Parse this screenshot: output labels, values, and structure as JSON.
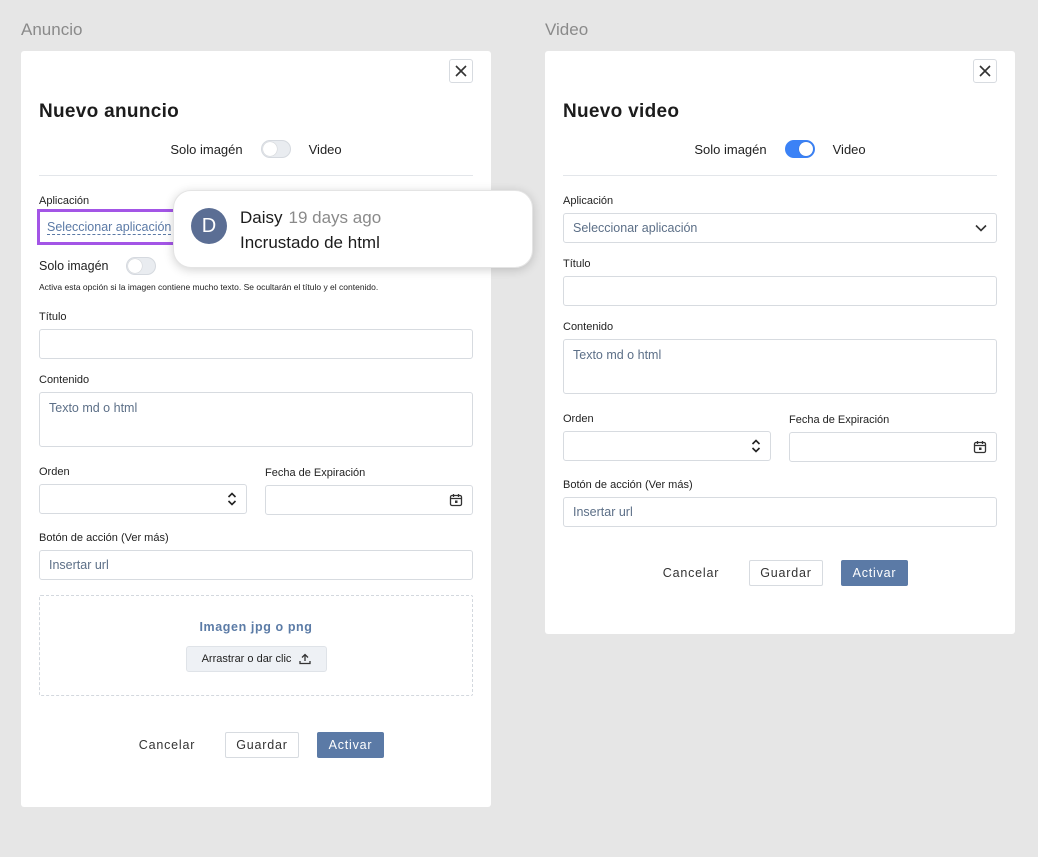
{
  "frames": {
    "left": {
      "label": "Anuncio",
      "title": "Nuevo anuncio",
      "toggle": {
        "left_label": "Solo imagén",
        "right_label": "Video",
        "on": false
      },
      "app_label": "Aplicación",
      "app_placeholder": "Seleccionar aplicación",
      "solo_label": "Solo imagén",
      "solo_hint": "Activa esta opción si la imagen contiene mucho texto. Se ocultarán el título y el contenido.",
      "titulo_label": "Título",
      "contenido_label": "Contenido",
      "contenido_placeholder": "Texto md o html",
      "orden_label": "Orden",
      "fecha_label": "Fecha de Expiración",
      "accion_label": "Botón de acción (Ver más)",
      "accion_placeholder": "Insertar url",
      "dropzone_title": "Imagen jpg o png",
      "dropzone_button": "Arrastrar o dar clic",
      "cancel": "Cancelar",
      "save": "Guardar",
      "activate": "Activar"
    },
    "right": {
      "label": "Video",
      "title": "Nuevo video",
      "toggle": {
        "left_label": "Solo imagén",
        "right_label": "Video",
        "on": true
      },
      "app_label": "Aplicación",
      "app_placeholder": "Seleccionar aplicación",
      "titulo_label": "Título",
      "contenido_label": "Contenido",
      "contenido_placeholder": "Texto md o html",
      "orden_label": "Orden",
      "fecha_label": "Fecha de Expiración",
      "accion_label": "Botón de acción (Ver más)",
      "accion_placeholder": "Insertar url",
      "cancel": "Cancelar",
      "save": "Guardar",
      "activate": "Activar"
    }
  },
  "comment": {
    "initial": "D",
    "author": "Daisy",
    "time": "19 days ago",
    "text": "Incrustado de html"
  },
  "colors": {
    "background": "#e6e6e6",
    "primary": "#5b7aa6",
    "toggle_on": "#3b82f6",
    "highlight": "#a355e6",
    "avatar": "#5b6e94"
  },
  "icons": [
    "close-icon",
    "chevron-down-icon",
    "stepper-icon",
    "calendar-icon",
    "upload-icon"
  ]
}
